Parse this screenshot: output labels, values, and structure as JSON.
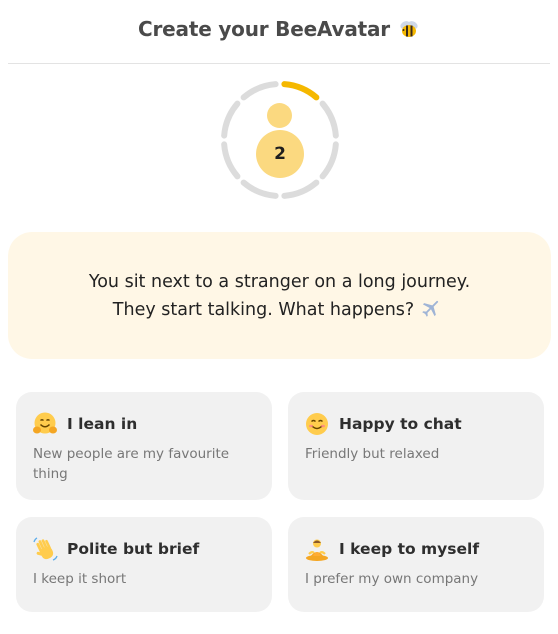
{
  "header": {
    "title": "Create your BeeAvatar",
    "icon": "bee-icon"
  },
  "progress": {
    "step": "2",
    "segments_total": 8,
    "segments_complete": 1,
    "active_color": "#f5b800",
    "inactive_color": "#dcdcdc"
  },
  "question": {
    "line1": "You sit next to a stranger on a long journey.",
    "line2": "They start talking. What happens?",
    "icon": "airplane-icon"
  },
  "options": [
    {
      "title": "I lean in",
      "description": "New people are my favourite thing",
      "icon": "hugging-face-icon"
    },
    {
      "title": "Happy to chat",
      "description": "Friendly but relaxed",
      "icon": "smiling-face-icon"
    },
    {
      "title": "Polite but brief",
      "description": "I keep it short",
      "icon": "waving-hand-icon"
    },
    {
      "title": "I keep to myself",
      "description": "I prefer my own company",
      "icon": "meditating-person-icon"
    }
  ],
  "colors": {
    "accent": "#f5b800",
    "avatar": "#fbd980",
    "question_bg": "#fff7e6",
    "card_bg": "#f1f1f1"
  }
}
